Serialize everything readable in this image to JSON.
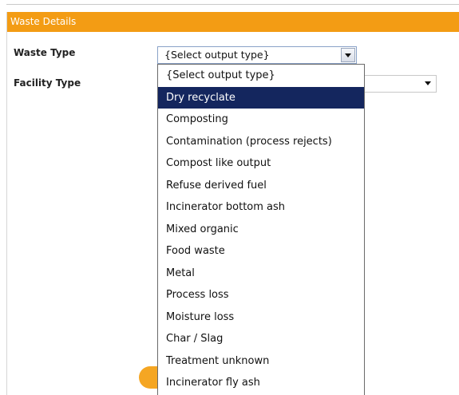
{
  "panel": {
    "title": "Waste Details"
  },
  "fields": {
    "waste_type_label": "Waste Type",
    "facility_type_label": "Facility Type",
    "waste_type_value": "{Select output type}"
  },
  "dropdown": {
    "options": [
      "{Select output type}",
      "Dry recyclate",
      "Composting",
      "Contamination (process rejects)",
      "Compost like output",
      "Refuse derived fuel",
      "Incinerator bottom ash",
      "Mixed organic",
      "Food waste",
      "Metal",
      "Process loss",
      "Moisture loss",
      "Char / Slag",
      "Treatment unknown",
      "Incinerator fly ash"
    ],
    "highlighted": "Dry recyclate"
  },
  "colors": {
    "header_orange": "#f39c14",
    "highlight_navy": "#14265e",
    "button_orange": "#f5a623"
  },
  "icons": {
    "dropdown_arrow": "chevron-down-icon"
  }
}
